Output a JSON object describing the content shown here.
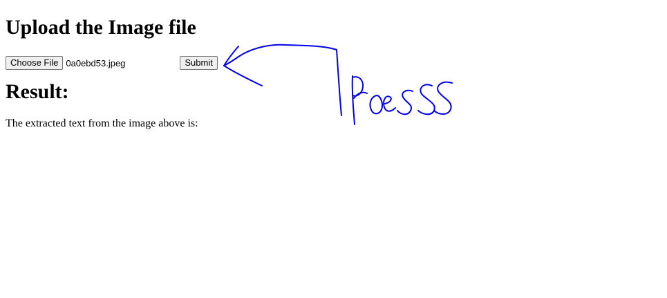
{
  "page": {
    "title": "Upload the Image file",
    "file_button_label": "Choose File",
    "file_name": "0a0ebd53.jpeg",
    "submit_label": "Submit",
    "result_heading": "Result:",
    "result_text": "The extracted text from the image above is:"
  },
  "annotation": {
    "handwritten_text": "Press",
    "ink_color": "#0000ee"
  }
}
